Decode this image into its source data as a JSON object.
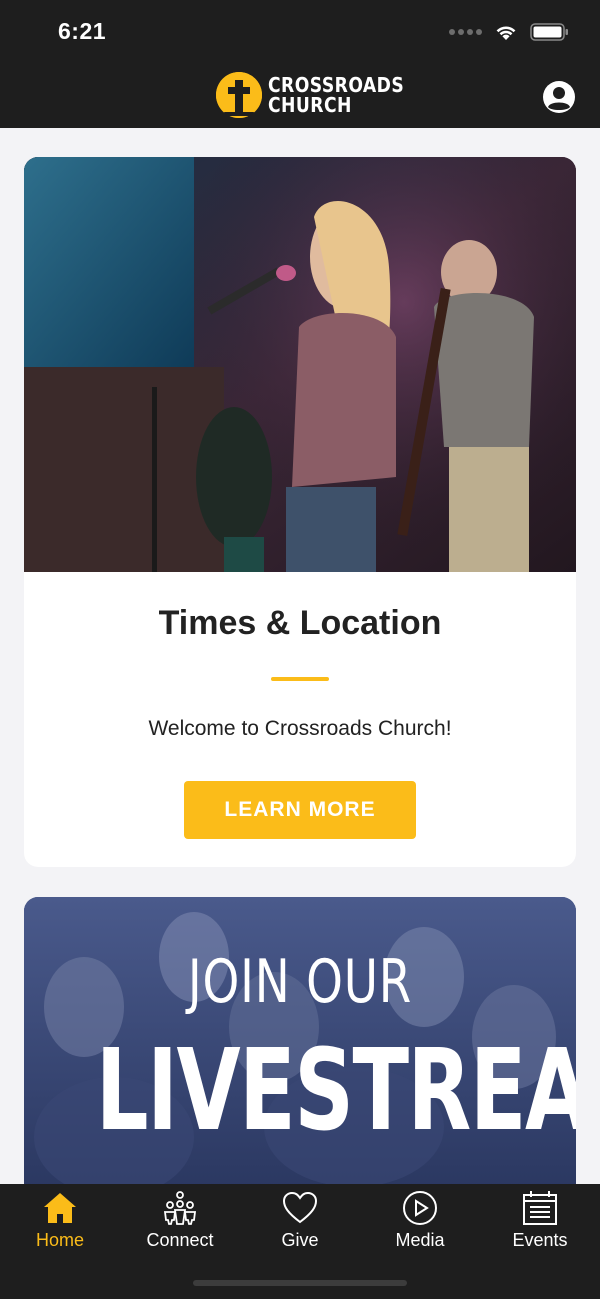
{
  "status_bar": {
    "time": "6:21",
    "icons": [
      "cellular-dots-icon",
      "wifi-icon",
      "battery-icon"
    ]
  },
  "header": {
    "logo_line1": "CROSSROADS",
    "logo_line2": "CHURCH",
    "logo_icon": "cross-icon",
    "profile_icon": "user-icon"
  },
  "colors": {
    "accent": "#fbbc19",
    "bar_background": "#1e1e1e",
    "page_background": "#f3f3f6",
    "title_text": "#222222"
  },
  "cards": [
    {
      "image": "worship-singer-photo",
      "title": "Times & Location",
      "text": "Welcome to Crossroads Church!",
      "button_label": "LEARN MORE"
    },
    {
      "image": "livestream-banner",
      "banner_line1": "JOIN OUR",
      "banner_line2": "LIVESTREAM"
    }
  ],
  "tabs": [
    {
      "label": "Home",
      "icon": "home-icon",
      "active": true
    },
    {
      "label": "Connect",
      "icon": "people-icon",
      "active": false
    },
    {
      "label": "Give",
      "icon": "heart-icon",
      "active": false
    },
    {
      "label": "Media",
      "icon": "play-icon",
      "active": false
    },
    {
      "label": "Events",
      "icon": "calendar-icon",
      "active": false
    }
  ]
}
